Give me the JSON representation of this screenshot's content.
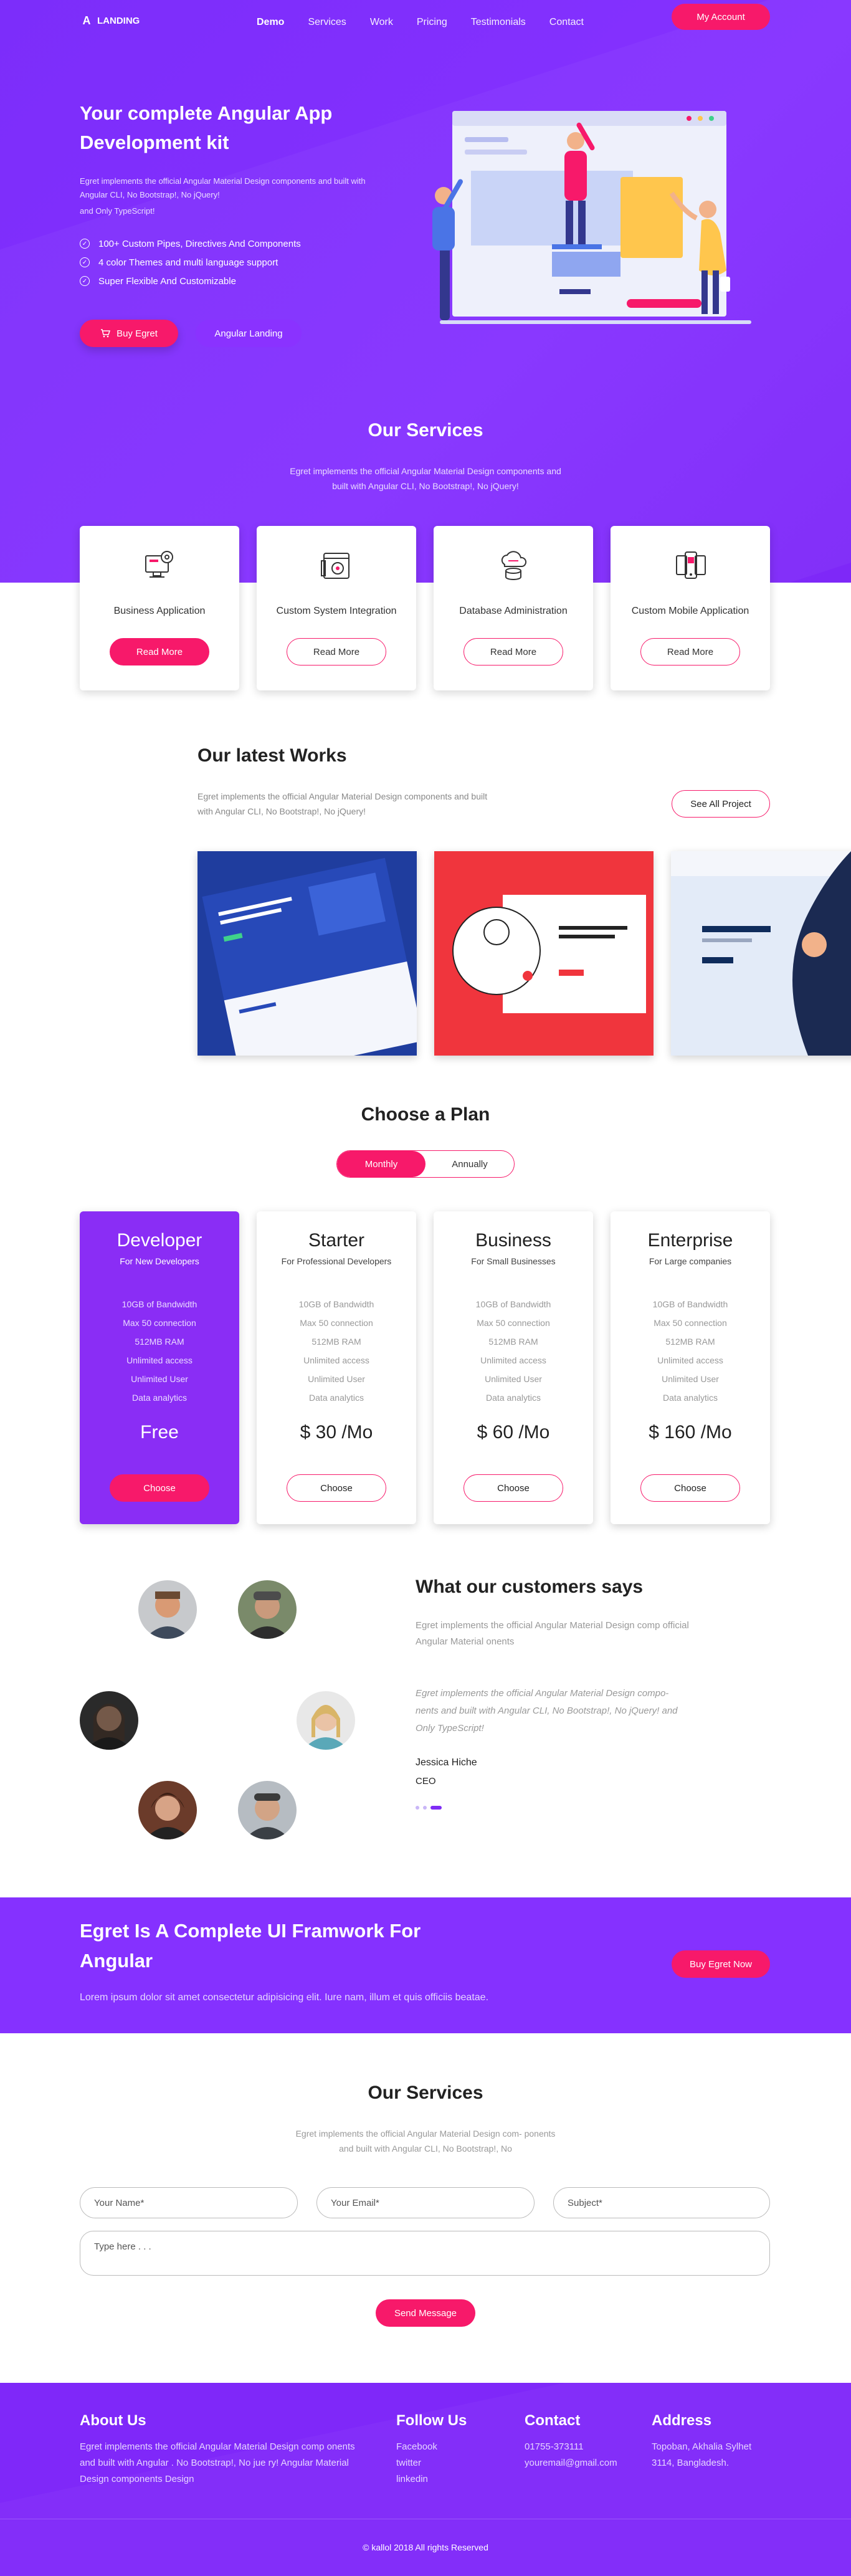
{
  "nav": {
    "logo_text": "LANDING",
    "logo_letter": "A",
    "items": [
      "Demo",
      "Services",
      "Work",
      "Pricing",
      "Testimonials",
      "Contact"
    ],
    "account_label": "My Account"
  },
  "hero": {
    "title": "Your complete Angular App Development kit",
    "description": "Egret implements the official Angular Material Design components and built with Angular CLI, No Bootstrap!, No jQuery!",
    "description2": "and Only TypeScript!",
    "features": [
      "100+ Custom Pipes, Directives And Components",
      "4 color Themes and multi language support",
      "Super Flexible And Customizable"
    ],
    "buy_label": "Buy Egret",
    "landing_label": "Angular Landing"
  },
  "services": {
    "title": "Our Services",
    "description": "Egret implements the official Angular Material Design components and built with Angular CLI, No Bootstrap!, No jQuery!",
    "items": [
      {
        "name": "Business Application",
        "button": "Read More",
        "icon": "monitor-gear-icon"
      },
      {
        "name": "Custom System Integration",
        "button": "Read More",
        "icon": "browser-gear-icon"
      },
      {
        "name": "Database Administration",
        "button": "Read More",
        "icon": "cloud-database-icon"
      },
      {
        "name": "Custom Mobile Application",
        "button": "Read More",
        "icon": "mobile-devices-icon"
      }
    ]
  },
  "works": {
    "title": "Our latest Works",
    "description": "Egret implements the official Angular Material Design components and built with Angular CLI, No Bootstrap!, No jQuery!",
    "see_all_label": "See All Project"
  },
  "pricing": {
    "title": "Choose a Plan",
    "toggle": [
      "Monthly",
      "Annually"
    ],
    "plans": [
      {
        "name": "Developer",
        "subtitle": "For New Developers",
        "features": [
          "10GB of Bandwidth",
          "Max 50 connection",
          "512MB RAM",
          "Unlimited access",
          "Unlimited User",
          "Data analytics"
        ],
        "price": "Free",
        "button": "Choose"
      },
      {
        "name": "Starter",
        "subtitle": "For Professional Developers",
        "features": [
          "10GB of Bandwidth",
          "Max 50 connection",
          "512MB RAM",
          "Unlimited access",
          "Unlimited User",
          "Data analytics"
        ],
        "price": "$ 30 /Mo",
        "button": "Choose"
      },
      {
        "name": "Business",
        "subtitle": "For Small Businesses",
        "features": [
          "10GB of Bandwidth",
          "Max 50 connection",
          "512MB RAM",
          "Unlimited access",
          "Unlimited User",
          "Data analytics"
        ],
        "price": "$ 60 /Mo",
        "button": "Choose"
      },
      {
        "name": "Enterprise",
        "subtitle": "For Large companies",
        "features": [
          "10GB of Bandwidth",
          "Max 50 connection",
          "512MB RAM",
          "Unlimited access",
          "Unlimited User",
          "Data analytics"
        ],
        "price": "$ 160 /Mo",
        "button": "Choose"
      }
    ]
  },
  "testimonials": {
    "title": "What our customers says",
    "description": "Egret implements the official Angular Material Design comp official Angular Material onents",
    "quote": "Egret implements the official Angular Material Design compo- nents and built with Angular CLI, No Bootstrap!, No jQuery! and Only TypeScript!",
    "name": "Jessica Hiche",
    "role": "CEO"
  },
  "cta": {
    "title": "Egret Is A Complete UI Framwork For Angular",
    "text": "Lorem ipsum dolor sit amet consectetur adipisicing elit. Iure nam, illum et quis officiis beatae.",
    "button": "Buy Egret Now"
  },
  "contact": {
    "title": "Our Services",
    "description": "Egret implements the official Angular Material Design com- ponents and built with Angular CLI, No Bootstrap!, No",
    "name_placeholder": "Your Name*",
    "email_placeholder": "Your Email*",
    "subject_placeholder": "Subject*",
    "message_placeholder": "Type here . . .",
    "send_label": "Send Message"
  },
  "footer": {
    "about_title": "About Us",
    "about_text": "Egret implements the official Angular Material Design comp onents and built with Angular . No Bootstrap!, No jue ry! Angular Material Design components Design",
    "follow_title": "Follow Us",
    "follow_links": [
      "Facebook",
      "twitter",
      "linkedin"
    ],
    "contact_title": "Contact",
    "phone": "01755-373111",
    "email": "youremail@gmail.com",
    "address_title": "Address",
    "address": "Topoban, Akhalia Sylhet 3114, Bangladesh.",
    "copyright": "© kallol 2018 All rights Reserved"
  },
  "colors": {
    "primary": "#8531ff",
    "accent": "#f7196a"
  }
}
